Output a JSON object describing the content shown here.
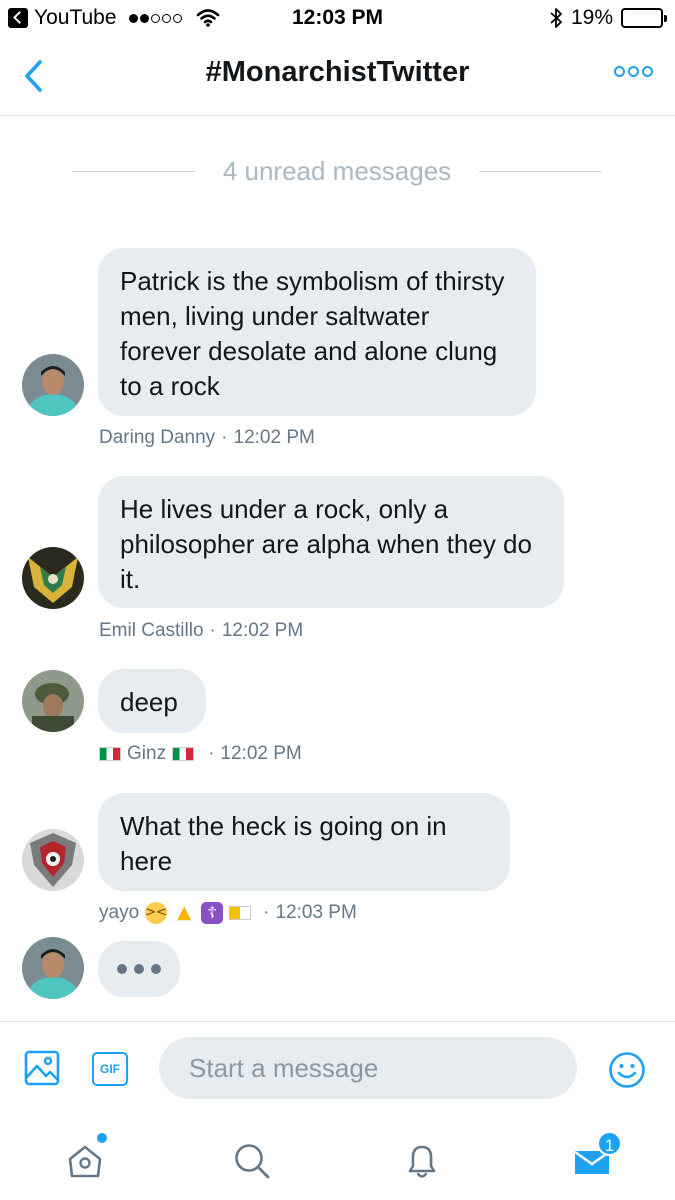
{
  "status_bar": {
    "back_app": "YouTube",
    "time": "12:03 PM",
    "battery": "19%",
    "battery_level": 0.19,
    "signal_bars_filled": 2,
    "signal_bars_total": 5
  },
  "header": {
    "title": "#MonarchistTwitter",
    "accent_color": "#1da1f2"
  },
  "unread_divider": "4 unread messages",
  "messages": [
    {
      "text": "Patrick is the symbolism of thirsty men, living under saltwater forever desolate and alone clung to a rock",
      "sender": "Daring Danny",
      "time": "12:02 PM"
    },
    {
      "text": "He lives under a rock, only a philosopher are alpha when they do it.",
      "sender": "Emil Castillo",
      "time": "12:02 PM"
    },
    {
      "text": "deep",
      "sender": "Ginz",
      "time": "12:02 PM"
    },
    {
      "text": "What the heck is going on in here",
      "sender": "yayo",
      "time": "12:03 PM"
    }
  ],
  "composer": {
    "placeholder": "Start a message",
    "gif_label": "GIF"
  },
  "tabbar": {
    "messages_badge": "1"
  }
}
